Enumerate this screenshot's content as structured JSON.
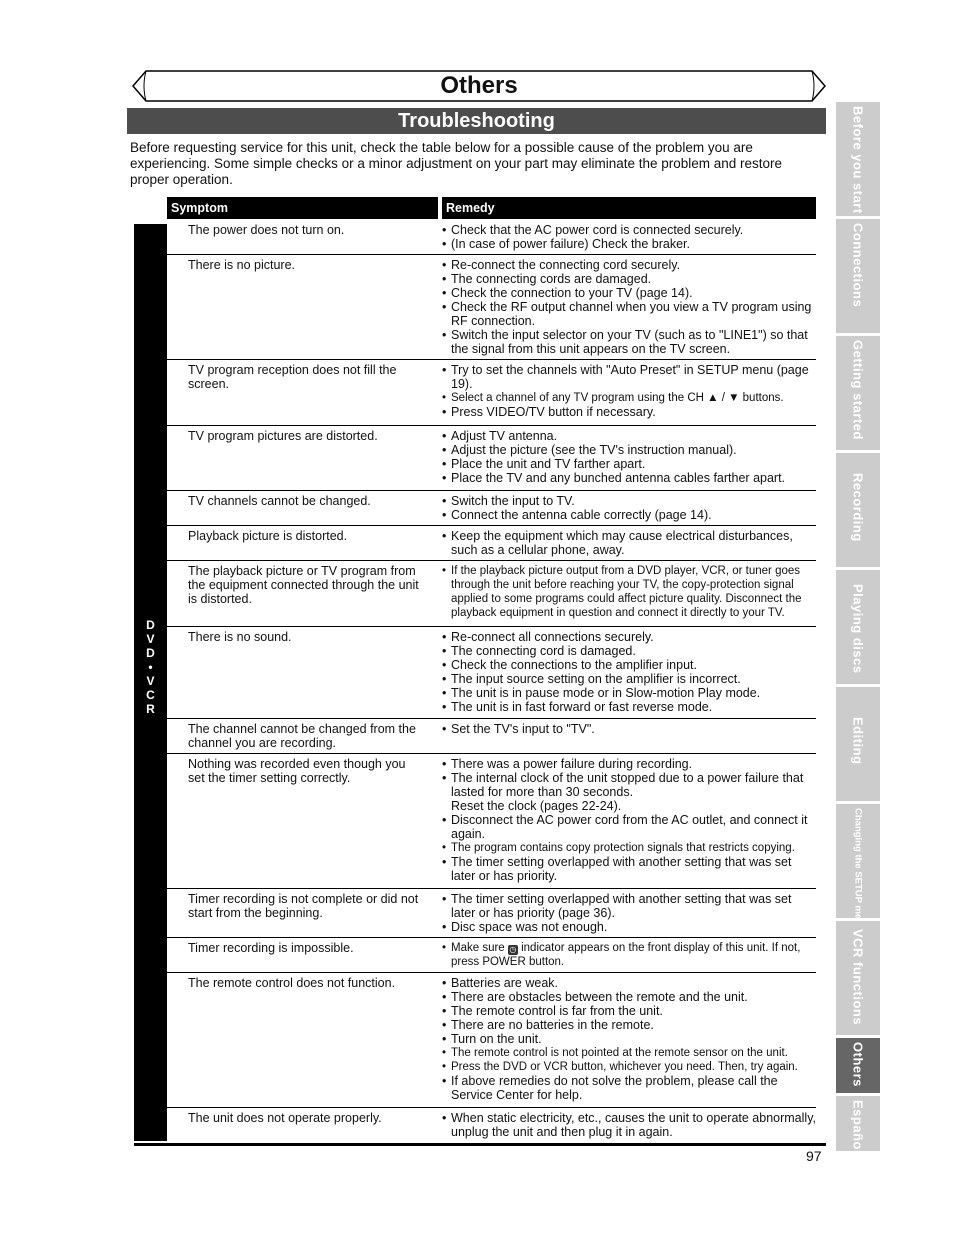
{
  "header": {
    "page_title": "Others",
    "section_title": "Troubleshooting",
    "intro": "Before requesting service for this unit, check the table below for a possible cause of the problem you are experiencing. Some simple checks or a minor adjustment on your part may eliminate the problem and restore proper operation."
  },
  "side_tabs": [
    {
      "label": "Before you start",
      "active": false
    },
    {
      "label": "Connections",
      "active": false
    },
    {
      "label": "Getting started",
      "active": false
    },
    {
      "label": "Recording",
      "active": false
    },
    {
      "label": "Playing discs",
      "active": false
    },
    {
      "label": "Editing",
      "active": false
    },
    {
      "label": "Changing the SETUP menu",
      "active": false
    },
    {
      "label": "VCR functions",
      "active": false
    },
    {
      "label": "Others",
      "active": true
    },
    {
      "label": "Español",
      "active": false
    }
  ],
  "table": {
    "headers": {
      "symptom": "Symptom",
      "remedy": "Remedy"
    },
    "category_label": [
      "D",
      "V",
      "D",
      "•",
      "V",
      "C",
      "R"
    ],
    "rows": [
      {
        "symptom": "The power does not turn on.",
        "remedies": [
          "Check that the AC power cord is connected securely.",
          "(In case of power failure) Check the braker."
        ]
      },
      {
        "symptom": "There is no picture.",
        "remedies": [
          "Re-connect the connecting cord securely.",
          "The connecting cords are damaged.",
          "Check the connection to your TV (page 14).",
          "Check the RF output channel when you view a TV program using RF connection.",
          "Switch the input selector on your TV (such as to \"LINE1\") so that the signal from this unit appears on the TV screen."
        ]
      },
      {
        "symptom": "TV program reception does not fill the screen.",
        "remedies": [
          "Try to set the channels with \"Auto Preset\" in SETUP menu (page 19).",
          "Select a channel of any TV program using the CH ▲ / ▼ buttons.",
          "Press VIDEO/TV button if necessary."
        ]
      },
      {
        "symptom": "TV program pictures are distorted.",
        "remedies": [
          "Adjust TV antenna.",
          "Adjust the picture (see the TV's instruction manual).",
          "Place the unit and TV farther apart.",
          "Place the TV and any bunched antenna cables farther apart."
        ]
      },
      {
        "symptom": "TV channels cannot be changed.",
        "remedies": [
          "Switch the input to TV.",
          "Connect the antenna cable correctly (page 14)."
        ]
      },
      {
        "symptom": "Playback picture is distorted.",
        "remedies": [
          "Keep the equipment which may cause electrical disturbances, such as a cellular phone, away."
        ]
      },
      {
        "symptom": "The playback picture or TV program from the equipment connected through the unit is distorted.",
        "remedies": [
          "If the playback picture output from a DVD player, VCR, or tuner goes through the unit before reaching your TV, the copy-protection signal applied to some programs could affect picture quality. Disconnect the playback equipment in question and connect it directly to your TV."
        ]
      },
      {
        "symptom": "There is no sound.",
        "remedies": [
          "Re-connect all connections securely.",
          "The connecting cord is damaged.",
          "Check the connections to the amplifier input.",
          "The input source setting on the amplifier is incorrect.",
          "The unit is in pause mode or in Slow-motion Play mode.",
          "The unit is in fast forward or fast reverse mode."
        ]
      },
      {
        "symptom": "The channel cannot be changed from the channel you are recording.",
        "remedies": [
          "Set the TV's input to \"TV\"."
        ]
      },
      {
        "symptom": "Nothing was recorded even though you set the timer setting correctly.",
        "remedies": [
          "There was a power failure during recording.",
          "The internal clock of the unit stopped due to a power failure that lasted for more than 30 seconds.",
          "Reset the clock (pages 22-24).",
          "Disconnect the AC power cord from the AC outlet, and connect it again.",
          "The program contains copy protection signals that restricts copying.",
          "The timer setting overlapped with another setting that was set later or has priority."
        ]
      },
      {
        "symptom": "Timer recording is not complete or did not start from the beginning.",
        "remedies": [
          "The timer setting overlapped with another setting that was set later or has priority (page 36).",
          "Disc space was not enough."
        ]
      },
      {
        "symptom": "Timer recording is impossible.",
        "remedies": [
          "Make sure",
          "indicator appears on the front display of this unit. If not, press POWER button."
        ],
        "icon": "clock-timer-icon"
      },
      {
        "symptom": "The remote control does not function.",
        "remedies": [
          "Batteries are weak.",
          "There are obstacles between the remote and the unit.",
          "The remote control is far from the unit.",
          "There are no batteries in the remote.",
          "Turn on the unit.",
          "The remote control is not pointed at the remote sensor on the unit.",
          "Press the DVD or VCR button, whichever you need. Then, try again.",
          "If above remedies do not solve the problem, please call the Service Center for help."
        ]
      },
      {
        "symptom": "The unit does not operate properly.",
        "remedies": [
          "When static electricity, etc., causes the unit to operate abnormally, unplug the unit and then plug it in again."
        ]
      }
    ]
  },
  "footer": {
    "page_number": "97"
  }
}
